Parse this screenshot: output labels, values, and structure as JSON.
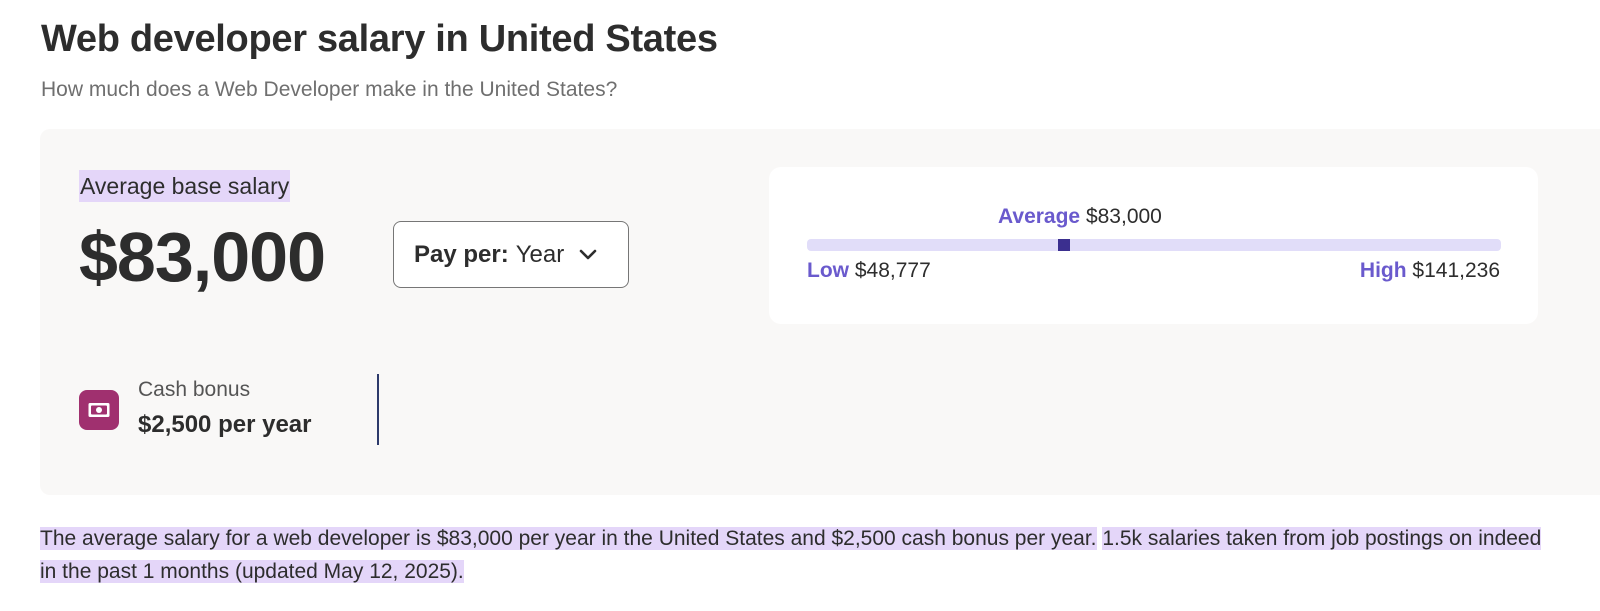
{
  "header": {
    "title": "Web developer salary in United States",
    "subtitle": "How much does a Web Developer make in the United States?"
  },
  "salary": {
    "average_label": "Average base salary",
    "average_amount": "$83,000",
    "pay_per": {
      "label": "Pay per:",
      "selected": "Year"
    }
  },
  "range": {
    "average_label": "Average",
    "average_value": "$83,000",
    "low_label": "Low",
    "low_value": "$48,777",
    "high_label": "High",
    "high_value": "$141,236",
    "low_num": 48777,
    "high_num": 141236,
    "average_num": 83000
  },
  "bonus": {
    "label": "Cash bonus",
    "value": "$2,500 per year",
    "icon": "cash-icon"
  },
  "summary": {
    "sentence1": "The average salary for a web developer is $83,000 per year in the United States and $2,500 cash bonus per year.",
    "sentence2": "1.5k salaries taken from job postings on indeed in the past 1 months (updated May 12, 2025)."
  },
  "colors": {
    "accent_purple": "#6a5acd",
    "marker": "#3b2f8f",
    "bonus_icon_bg": "#a0306f",
    "highlight": "#e4d6f9"
  }
}
